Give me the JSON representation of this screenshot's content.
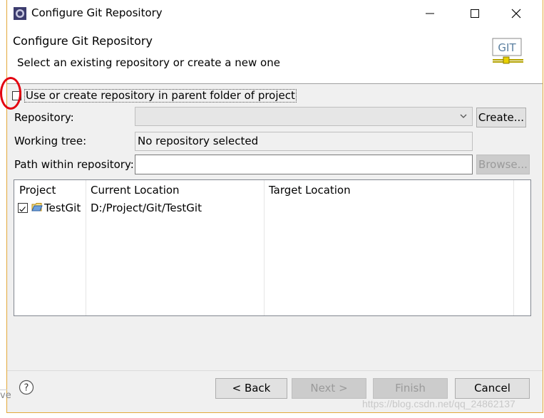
{
  "window": {
    "title": "Configure Git Repository"
  },
  "header": {
    "title": "Configure Git Repository",
    "subtitle": "Select an existing repository or create a new one",
    "logo_text": "GIT"
  },
  "options": {
    "use_parent_label": "Use or create repository in parent folder of project",
    "use_parent_checked": false
  },
  "fields": {
    "repository_label": "Repository:",
    "repository_value": "",
    "create_label": "Create...",
    "working_tree_label": "Working tree:",
    "working_tree_value": "No repository selected",
    "path_label": "Path within repository:",
    "path_value": "",
    "browse_label": "Browse..."
  },
  "table": {
    "columns": [
      "Project",
      "Current Location",
      "Target Location"
    ],
    "rows": [
      {
        "checked": true,
        "project": "TestGit",
        "current_location": "D:/Project/Git/TestGit",
        "target_location": ""
      }
    ]
  },
  "footer": {
    "back_label": "< Back",
    "next_label": "Next >",
    "finish_label": "Finish",
    "cancel_label": "Cancel"
  },
  "watermark": "https://blog.csdn.net/qq_24862137",
  "stray_text": "ve",
  "colors": {
    "highlight_circle": "#e3000f",
    "window_border": "#e2a93b",
    "disabled_text": "#9a9a9a"
  }
}
